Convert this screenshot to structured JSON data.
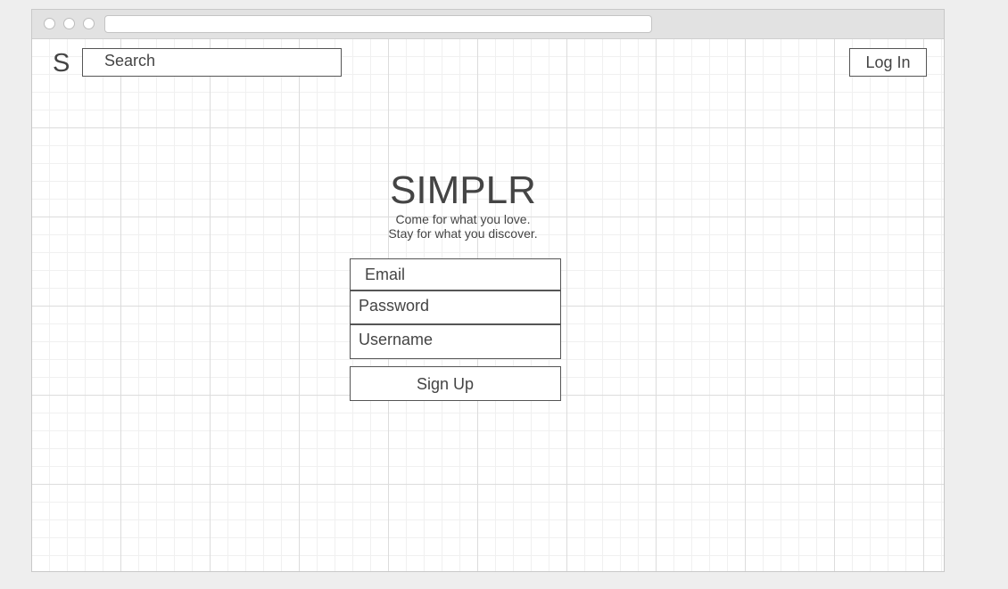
{
  "header": {
    "logo": "S",
    "search_placeholder": "Search",
    "login_label": "Log In"
  },
  "hero": {
    "title": "SIMPLR",
    "tagline_line1": "Come for what you love.",
    "tagline_line2": "Stay for what you discover."
  },
  "signup_form": {
    "email_placeholder": "Email",
    "password_placeholder": "Password",
    "username_placeholder": "Username",
    "submit_label": "Sign Up"
  },
  "colors": {
    "text": "#444444",
    "border": "#555555",
    "grid_major": "#dcdcdc",
    "grid_minor": "#f0f0f0",
    "titlebar": "#e2e2e2",
    "background": "#eeeeee"
  }
}
